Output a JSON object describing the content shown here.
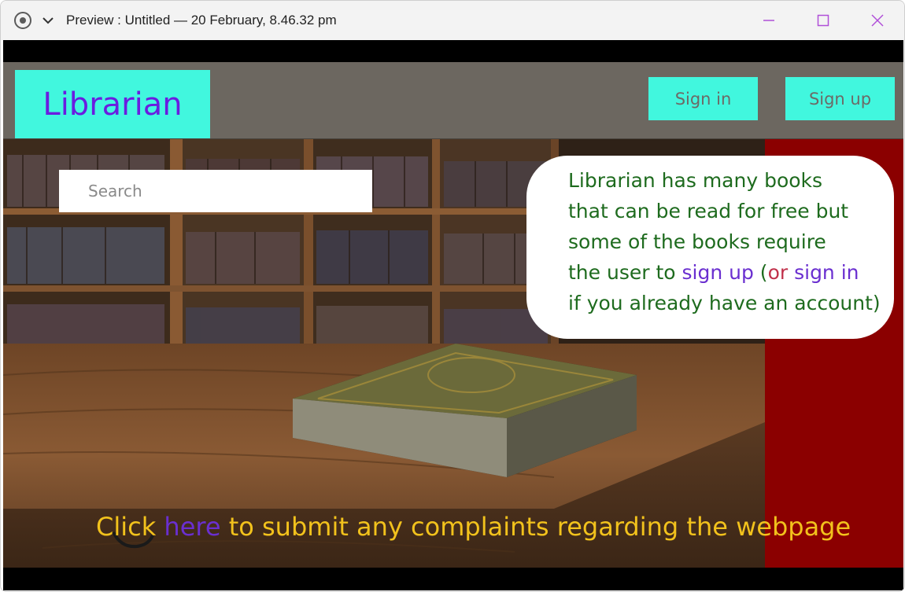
{
  "window": {
    "title": "Preview : Untitled — 20 February, 8.46.32 pm"
  },
  "navbar": {
    "logo": "Librarian",
    "signin_label": "Sign in",
    "signup_label": "Sign up"
  },
  "search": {
    "placeholder": "Search"
  },
  "info_bubble": {
    "line1": "Librarian has many books",
    "line2": "that can be read for free but",
    "line3": "some of the books require",
    "line4_pre": "the user to ",
    "signup_link": "sign up",
    "paren_open": " (",
    "or_word": "or",
    "space": " ",
    "signin_link": "sign in",
    "line5": "if you already have an account)"
  },
  "footer_banner": {
    "pre": "Click ",
    "link": "here",
    "post": " to submit any complaints regarding the webpage"
  },
  "colors": {
    "accent_cyan": "#41f7de",
    "logo_purple": "#6a1de0",
    "panel_red": "#8b0000",
    "bubble_green": "#1e6b1e",
    "banner_yellow": "#f2c21c"
  }
}
